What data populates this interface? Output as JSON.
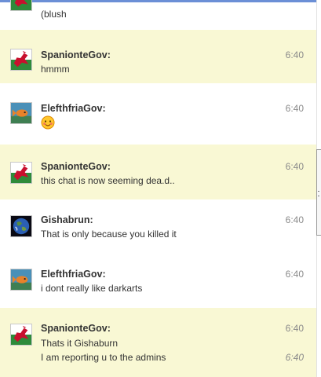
{
  "messages": [
    {
      "sender": "",
      "avatar": "welsh-dragon-avatar",
      "lines": [
        "(blush"
      ],
      "time": ""
    },
    {
      "sender": "SpanionteGov:",
      "avatar": "welsh-dragon-avatar",
      "lines": [
        "hmmm"
      ],
      "time": "6:40"
    },
    {
      "sender": "ElefthfriaGov:",
      "avatar": "fish-avatar",
      "lines": [],
      "emoji": "blush-emoji",
      "time": "6:40"
    },
    {
      "sender": "SpanionteGov:",
      "avatar": "welsh-dragon-avatar",
      "lines": [
        "this chat is now seeming dea.d.."
      ],
      "time": "6:40"
    },
    {
      "sender": "Gishabrun:",
      "avatar": "earth-avatar",
      "lines": [
        "That is only because you killed it"
      ],
      "time": "6:40"
    },
    {
      "sender": "ElefthfriaGov:",
      "avatar": "fish-avatar",
      "lines": [
        "i dont really like darkarts"
      ],
      "time": "6:40"
    },
    {
      "sender": "SpanionteGov:",
      "avatar": "welsh-dragon-avatar",
      "lines": [
        "Thats it Gishaburn",
        "I am reporting u to the admins"
      ],
      "time": "6:40",
      "line_times": [
        "",
        "6:40"
      ]
    }
  ],
  "colors": {
    "highlight": "#f9f8d4",
    "top_border": "#6b8fd6",
    "timestamp": "#8a8a8a"
  }
}
